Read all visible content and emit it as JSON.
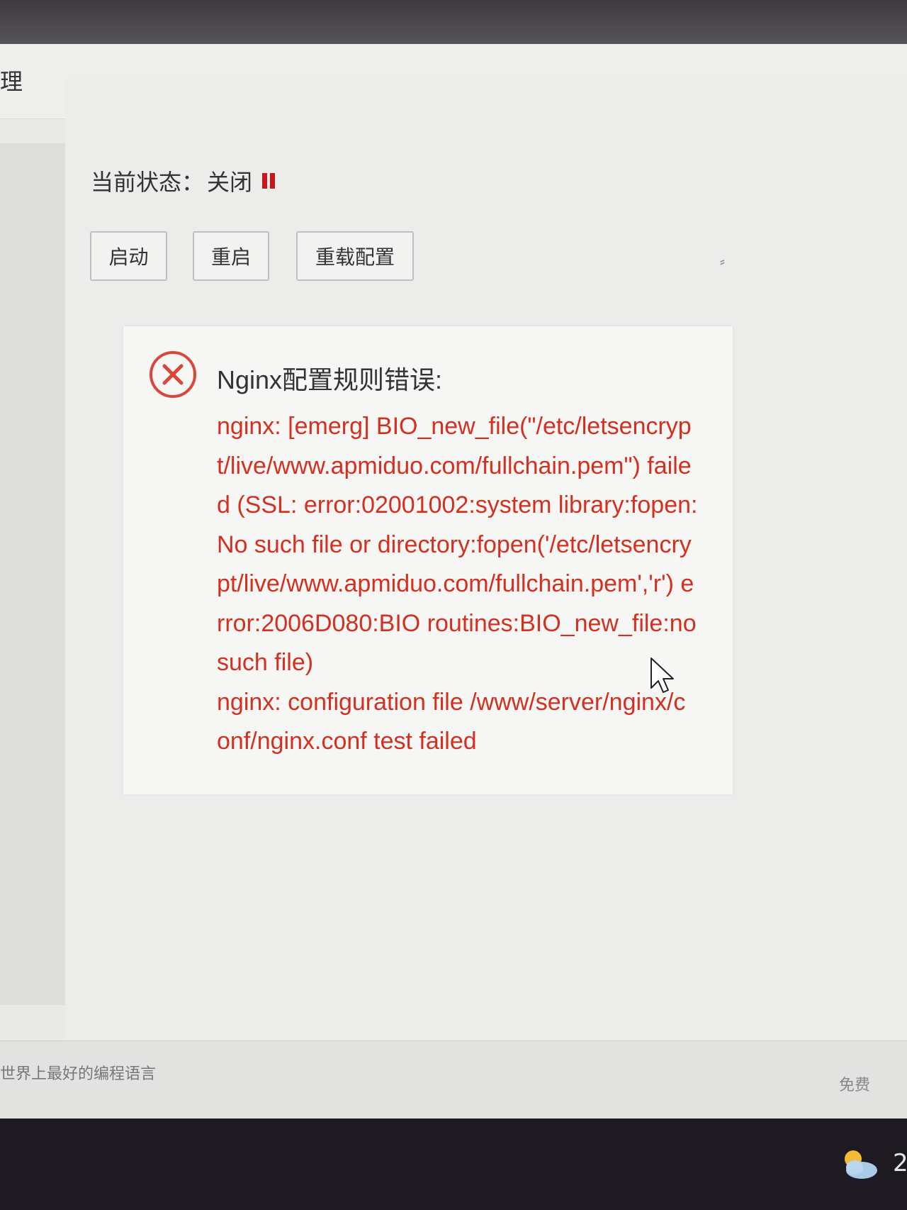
{
  "header": {
    "title": "理"
  },
  "status": {
    "label": "当前状态：",
    "value": "关闭"
  },
  "buttons": {
    "start": "启动",
    "restart": "重启",
    "reload": "重载配置"
  },
  "dialog": {
    "title": "Nginx配置规则错误:",
    "message": "nginx: [emerg] BIO_new_file(\"/etc/letsencrypt/live/www.apmiduo.com/fullchain.pem\") failed (SSL: error:02001002:system library:fopen:No such file or directory:fopen('/etc/letsencrypt/live/www.apmiduo.com/fullchain.pem','r') error:2006D080:BIO routines:BIO_new_file:no such file)\nnginx: configuration file /www/server/nginx/conf/nginx.conf test failed"
  },
  "footer": {
    "slogan": "世界上最好的编程语言",
    "right_text": "免费"
  },
  "taskbar": {
    "clock_partial": "2"
  },
  "colors": {
    "error_red": "#d4301f",
    "status_red": "#c8161d"
  }
}
